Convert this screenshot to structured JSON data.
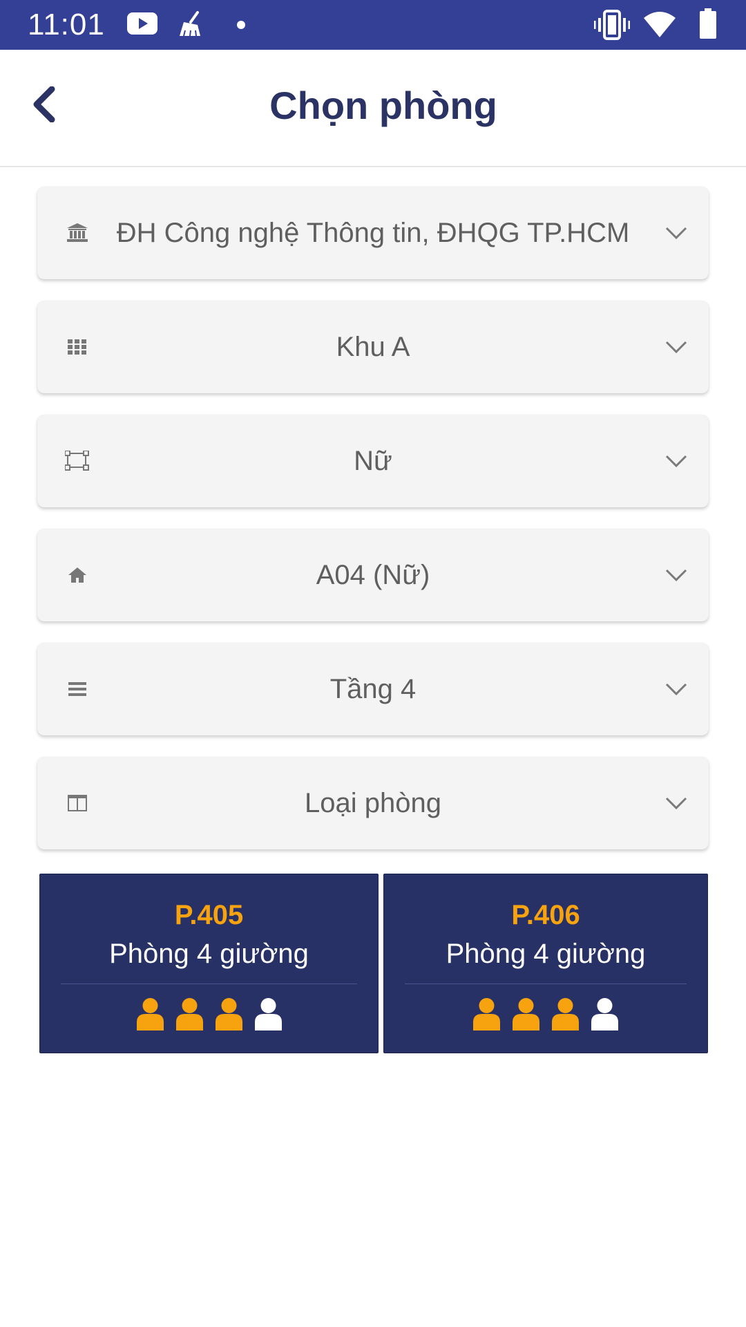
{
  "status_bar": {
    "time": "11:01"
  },
  "header": {
    "title": "Chọn phòng"
  },
  "selects": [
    {
      "icon": "university-icon",
      "value": "ĐH Công nghệ Thông tin, ĐHQG TP.HCM"
    },
    {
      "icon": "grid-icon",
      "value": "Khu A"
    },
    {
      "icon": "object-group-icon",
      "value": "Nữ"
    },
    {
      "icon": "home-icon",
      "value": "A04 (Nữ)"
    },
    {
      "icon": "menu-lines-icon",
      "value": "Tầng 4"
    },
    {
      "icon": "columns-icon",
      "value": "Loại phòng"
    }
  ],
  "rooms": [
    {
      "code": "P.405",
      "type": "Phòng 4 giường",
      "beds_total": 4,
      "beds_occupied": 3
    },
    {
      "code": "P.406",
      "type": "Phòng 4 giường",
      "beds_total": 4,
      "beds_occupied": 3
    }
  ],
  "colors": {
    "status_bar": "#334096",
    "title": "#2a3363",
    "room_card": "#283166",
    "occupied_bed": "#f7a20f",
    "free_bed": "#ffffff"
  }
}
